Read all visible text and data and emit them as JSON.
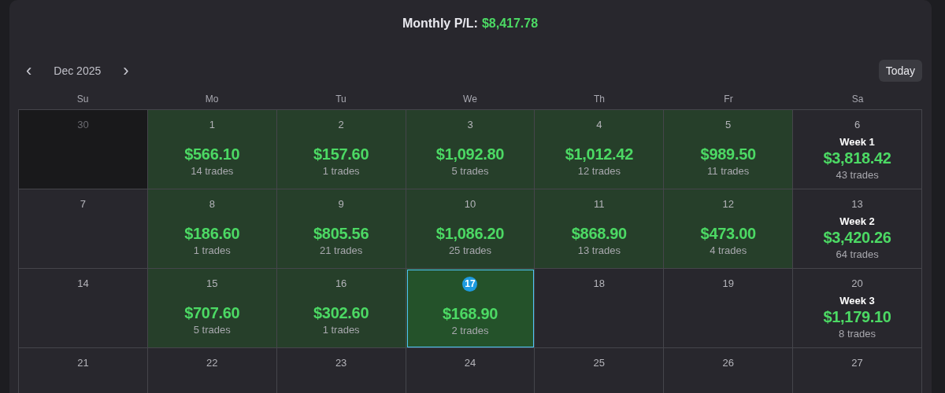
{
  "header": {
    "label": "Monthly P/L:",
    "value": "$8,417.78"
  },
  "nav": {
    "prev": "‹",
    "month": "Dec 2025",
    "next": "›",
    "today_button": "Today"
  },
  "weekdays": [
    "Su",
    "Mo",
    "Tu",
    "We",
    "Th",
    "Fr",
    "Sa"
  ],
  "rows": [
    [
      {
        "kind": "outside",
        "date": "30",
        "today": false
      },
      {
        "kind": "trade",
        "date": "1",
        "pnl": "$566.10",
        "trades": "14 trades",
        "today": false
      },
      {
        "kind": "trade",
        "date": "2",
        "pnl": "$157.60",
        "trades": "1 trades",
        "today": false
      },
      {
        "kind": "trade",
        "date": "3",
        "pnl": "$1,092.80",
        "trades": "5 trades",
        "today": false
      },
      {
        "kind": "trade",
        "date": "4",
        "pnl": "$1,012.42",
        "trades": "12 trades",
        "today": false
      },
      {
        "kind": "trade",
        "date": "5",
        "pnl": "$989.50",
        "trades": "11 trades",
        "today": false
      },
      {
        "kind": "week",
        "date": "6",
        "week": "Week 1",
        "pnl": "$3,818.42",
        "trades": "43 trades",
        "today": false
      }
    ],
    [
      {
        "kind": "empty",
        "date": "7",
        "today": false
      },
      {
        "kind": "trade",
        "date": "8",
        "pnl": "$186.60",
        "trades": "1 trades",
        "today": false
      },
      {
        "kind": "trade",
        "date": "9",
        "pnl": "$805.56",
        "trades": "21 trades",
        "today": false
      },
      {
        "kind": "trade",
        "date": "10",
        "pnl": "$1,086.20",
        "trades": "25 trades",
        "today": false
      },
      {
        "kind": "trade",
        "date": "11",
        "pnl": "$868.90",
        "trades": "13 trades",
        "today": false
      },
      {
        "kind": "trade",
        "date": "12",
        "pnl": "$473.00",
        "trades": "4 trades",
        "today": false
      },
      {
        "kind": "week",
        "date": "13",
        "week": "Week 2",
        "pnl": "$3,420.26",
        "trades": "64 trades",
        "today": false
      }
    ],
    [
      {
        "kind": "empty",
        "date": "14",
        "today": false
      },
      {
        "kind": "trade",
        "date": "15",
        "pnl": "$707.60",
        "trades": "5 trades",
        "today": false
      },
      {
        "kind": "trade",
        "date": "16",
        "pnl": "$302.60",
        "trades": "1 trades",
        "today": false
      },
      {
        "kind": "trade",
        "date": "17",
        "pnl": "$168.90",
        "trades": "2 trades",
        "today": true
      },
      {
        "kind": "empty",
        "date": "18",
        "today": false
      },
      {
        "kind": "empty",
        "date": "19",
        "today": false
      },
      {
        "kind": "week",
        "date": "20",
        "week": "Week 3",
        "pnl": "$1,179.10",
        "trades": "8 trades",
        "today": false
      }
    ],
    [
      {
        "kind": "empty",
        "date": "21",
        "today": false
      },
      {
        "kind": "empty",
        "date": "22",
        "today": false
      },
      {
        "kind": "empty",
        "date": "23",
        "today": false
      },
      {
        "kind": "empty",
        "date": "24",
        "today": false
      },
      {
        "kind": "empty",
        "date": "25",
        "today": false
      },
      {
        "kind": "empty",
        "date": "26",
        "today": false
      },
      {
        "kind": "empty",
        "date": "27",
        "today": false
      }
    ]
  ]
}
